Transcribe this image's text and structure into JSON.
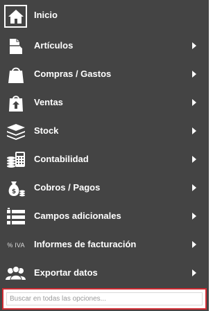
{
  "menu": {
    "items": [
      {
        "label": "Inicio",
        "icon": "home-icon",
        "has_submenu": false
      },
      {
        "label": "Artículos",
        "icon": "boxes-icon",
        "has_submenu": true
      },
      {
        "label": "Compras / Gastos",
        "icon": "shopping-bag-icon",
        "has_submenu": true
      },
      {
        "label": "Ventas",
        "icon": "sale-bag-icon",
        "has_submenu": true
      },
      {
        "label": "Stock",
        "icon": "layers-icon",
        "has_submenu": true
      },
      {
        "label": "Contabilidad",
        "icon": "calculator-icon",
        "has_submenu": true
      },
      {
        "label": "Cobros / Pagos",
        "icon": "money-bag-icon",
        "has_submenu": true
      },
      {
        "label": "Campos adicionales",
        "icon": "list-fields-icon",
        "has_submenu": true
      },
      {
        "label": "Informes de facturación",
        "icon": "percent-iva-icon",
        "icon_text": "% IVA",
        "has_submenu": true
      },
      {
        "label": "Exportar datos",
        "icon": "users-icon",
        "has_submenu": true
      }
    ]
  },
  "search": {
    "placeholder": "Buscar en todas las opciones..."
  },
  "colors": {
    "panel_bg": "#444444",
    "text": "#ffffff",
    "search_border": "#d12b33"
  }
}
